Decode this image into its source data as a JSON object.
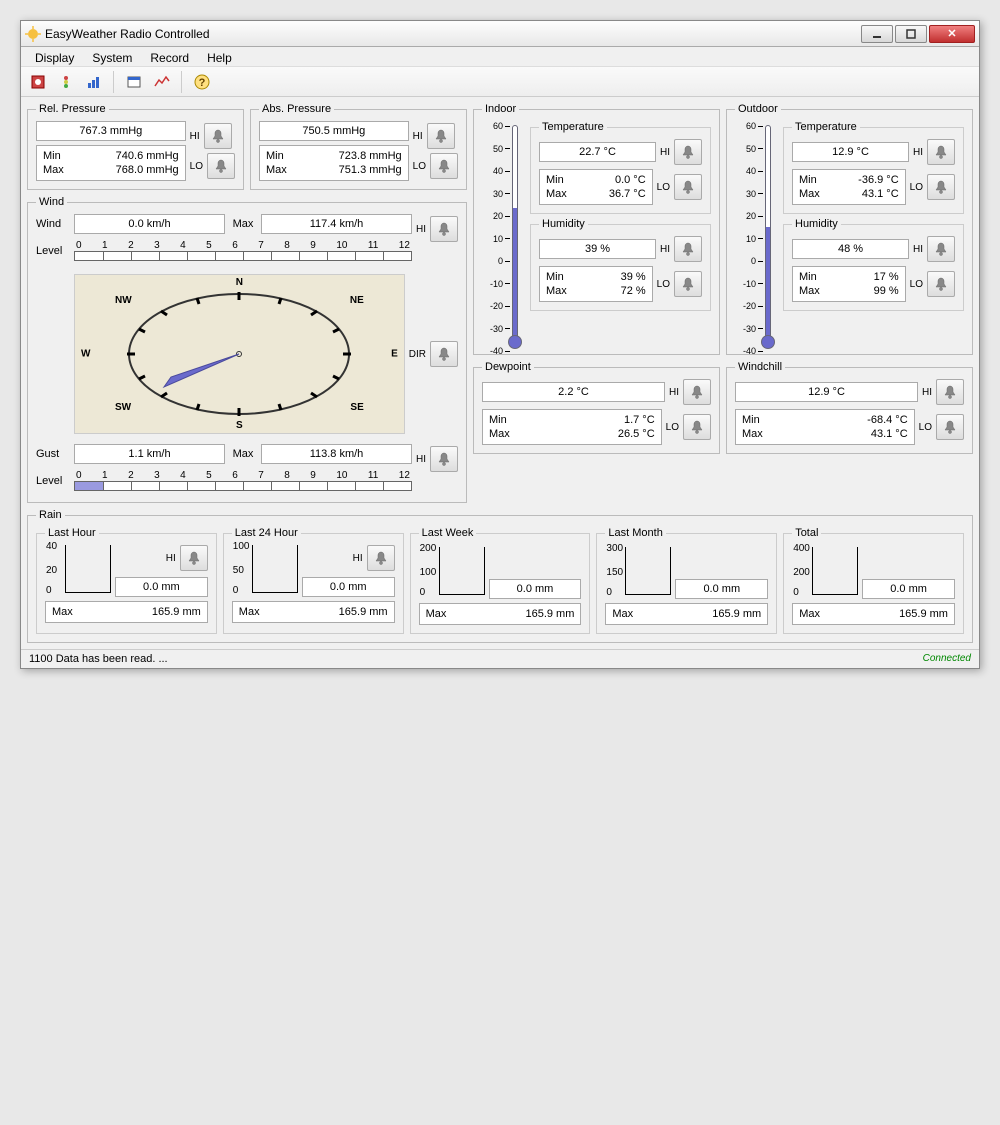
{
  "window": {
    "title": "EasyWeather Radio Controlled"
  },
  "menu": {
    "display": "Display",
    "system": "System",
    "record": "Record",
    "help": "Help"
  },
  "labels": {
    "rel_pressure": "Rel. Pressure",
    "abs_pressure": "Abs. Pressure",
    "hi": "HI",
    "lo": "LO",
    "dir": "DIR",
    "min": "Min",
    "max": "Max",
    "wind": "Wind",
    "level": "Level",
    "gust": "Gust",
    "indoor": "Indoor",
    "outdoor": "Outdoor",
    "temperature": "Temperature",
    "humidity": "Humidity",
    "dewpoint": "Dewpoint",
    "windchill": "Windchill",
    "rain": "Rain",
    "last_hour": "Last Hour",
    "last_24": "Last 24 Hour",
    "last_week": "Last Week",
    "last_month": "Last Month",
    "total": "Total"
  },
  "rel_pressure": {
    "value": "767.3 mmHg",
    "min": "740.6 mmHg",
    "max": "768.0 mmHg"
  },
  "abs_pressure": {
    "value": "750.5 mmHg",
    "min": "723.8 mmHg",
    "max": "751.3 mmHg"
  },
  "wind": {
    "value": "0.0 km/h",
    "max": "117.4 km/h",
    "level": 0
  },
  "gust": {
    "value": "1.1 km/h",
    "max": "113.8 km/h",
    "level": 1
  },
  "indoor": {
    "temp": {
      "value": "22.7 °C",
      "min": "0.0 °C",
      "max": "36.7 °C",
      "fill_pct": 62
    },
    "humidity": {
      "value": "39 %",
      "min": "39 %",
      "max": "72 %"
    }
  },
  "outdoor": {
    "temp": {
      "value": "12.9 °C",
      "min": "-36.9 °C",
      "max": "43.1 °C",
      "fill_pct": 53
    },
    "humidity": {
      "value": "48 %",
      "min": "17 %",
      "max": "99 %"
    }
  },
  "dewpoint": {
    "value": "2.2 °C",
    "min": "1.7 °C",
    "max": "26.5 °C"
  },
  "windchill": {
    "value": "12.9 °C",
    "min": "-68.4 °C",
    "max": "43.1 °C"
  },
  "rain": {
    "hour": {
      "value": "0.0 mm",
      "max": "165.9 mm",
      "ytop": "40",
      "ymid": "20"
    },
    "day": {
      "value": "0.0 mm",
      "max": "165.9 mm",
      "ytop": "100",
      "ymid": "50"
    },
    "week": {
      "value": "0.0 mm",
      "max": "165.9 mm",
      "ytop": "200",
      "ymid": "100"
    },
    "month": {
      "value": "0.0 mm",
      "max": "165.9 mm",
      "ytop": "300",
      "ymid": "150"
    },
    "total": {
      "value": "0.0 mm",
      "max": "165.9 mm",
      "ytop": "400",
      "ymid": "200"
    }
  },
  "status": {
    "message": "1100 Data has been read. ...",
    "connected": "Connected"
  },
  "thermo_scale": [
    "60",
    "50",
    "40",
    "30",
    "20",
    "10",
    "0",
    "-10",
    "-20",
    "-30",
    "-40"
  ],
  "level_scale": [
    "0",
    "1",
    "2",
    "3",
    "4",
    "5",
    "6",
    "7",
    "8",
    "9",
    "10",
    "11",
    "12"
  ]
}
